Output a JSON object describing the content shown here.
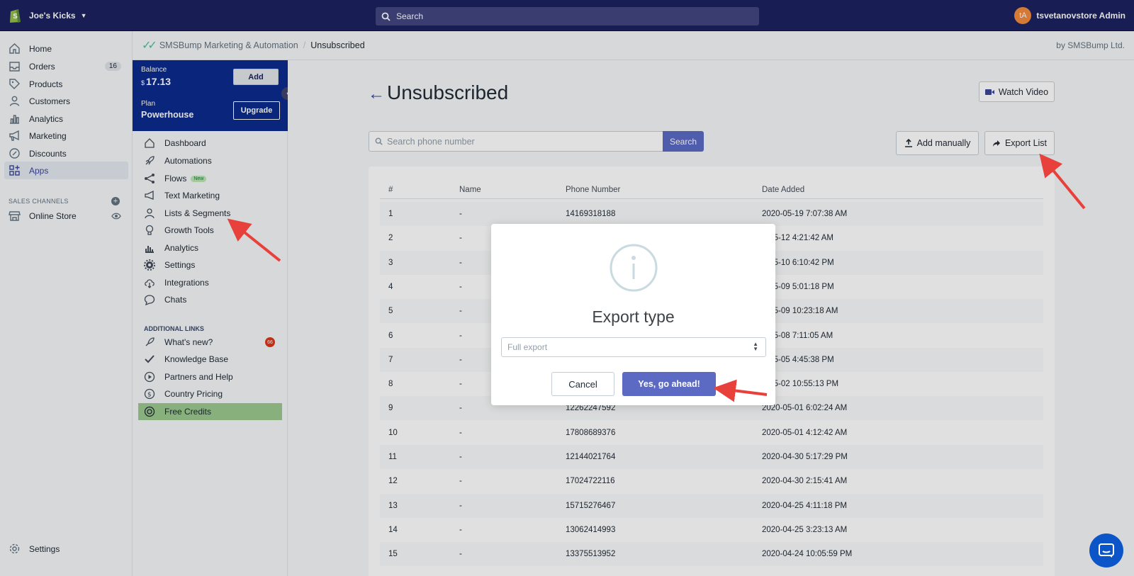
{
  "topbar": {
    "store_name": "Joe's Kicks",
    "search_placeholder": "Search",
    "user_initials": "tA",
    "user_name": "tsvetanovstore Admin"
  },
  "leftnav": {
    "items": [
      {
        "label": "Home"
      },
      {
        "label": "Orders",
        "badge": "16"
      },
      {
        "label": "Products"
      },
      {
        "label": "Customers"
      },
      {
        "label": "Analytics"
      },
      {
        "label": "Marketing"
      },
      {
        "label": "Discounts"
      },
      {
        "label": "Apps"
      }
    ],
    "sales_channels_label": "SALES CHANNELS",
    "online_store": "Online Store",
    "settings": "Settings"
  },
  "breadcrumb": {
    "app": "SMSBump Marketing & Automation",
    "current": "Unsubscribed",
    "by": "by SMSBump Ltd."
  },
  "appside": {
    "balance_label": "Balance",
    "balance_currency": "$",
    "balance_value": "17.13",
    "plan_label": "Plan",
    "plan_value": "Powerhouse",
    "add_label": "Add",
    "upgrade_label": "Upgrade",
    "items": [
      {
        "label": "Dashboard"
      },
      {
        "label": "Automations"
      },
      {
        "label": "Flows",
        "tag": "New"
      },
      {
        "label": "Text Marketing"
      },
      {
        "label": "Lists & Segments"
      },
      {
        "label": "Growth Tools"
      },
      {
        "label": "Analytics"
      },
      {
        "label": "Settings"
      },
      {
        "label": "Integrations"
      },
      {
        "label": "Chats"
      }
    ],
    "additional_label": "ADDITIONAL LINKS",
    "links": [
      {
        "label": "What's new?",
        "badge": "66"
      },
      {
        "label": "Knowledge Base"
      },
      {
        "label": "Partners and Help"
      },
      {
        "label": "Country Pricing"
      },
      {
        "label": "Free Credits"
      }
    ]
  },
  "main": {
    "title": "Unsubscribed",
    "watch_video": "Watch Video",
    "search_placeholder": "Search phone number",
    "search_button": "Search",
    "add_manually": "Add manually",
    "export_list": "Export List",
    "columns": [
      "#",
      "Name",
      "Phone Number",
      "Date Added"
    ],
    "rows": [
      [
        "1",
        "-",
        "14169318188",
        "2020-05-19 7:07:38 AM"
      ],
      [
        "2",
        "-",
        "",
        "0-05-12 4:21:42 AM"
      ],
      [
        "3",
        "-",
        "",
        "0-05-10 6:10:42 PM"
      ],
      [
        "4",
        "-",
        "",
        "0-05-09 5:01:18 PM"
      ],
      [
        "5",
        "-",
        "",
        "0-05-09 10:23:18 AM"
      ],
      [
        "6",
        "-",
        "",
        "0-05-08 7:11:05 AM"
      ],
      [
        "7",
        "-",
        "",
        "0-05-05 4:45:38 PM"
      ],
      [
        "8",
        "-",
        "",
        "0-05-02 10:55:13 PM"
      ],
      [
        "9",
        "-",
        "12262247592",
        "2020-05-01 6:02:24 AM"
      ],
      [
        "10",
        "-",
        "17808689376",
        "2020-05-01 4:12:42 AM"
      ],
      [
        "11",
        "-",
        "12144021764",
        "2020-04-30 5:17:29 PM"
      ],
      [
        "12",
        "-",
        "17024722116",
        "2020-04-30 2:15:41 AM"
      ],
      [
        "13",
        "-",
        "15715276467",
        "2020-04-25 4:11:18 PM"
      ],
      [
        "14",
        "-",
        "13062414993",
        "2020-04-25 3:23:13 AM"
      ],
      [
        "15",
        "-",
        "13375513952",
        "2020-04-24 10:05:59 PM"
      ]
    ]
  },
  "modal": {
    "title": "Export type",
    "select_value": "Full export",
    "cancel": "Cancel",
    "confirm": "Yes, go ahead!"
  },
  "colors": {
    "topbar": "#1c2260",
    "primary": "#5c6ac4",
    "balance_panel": "#0b2b8e",
    "highlight": "#9bc98f",
    "arrow": "#e8403a"
  }
}
